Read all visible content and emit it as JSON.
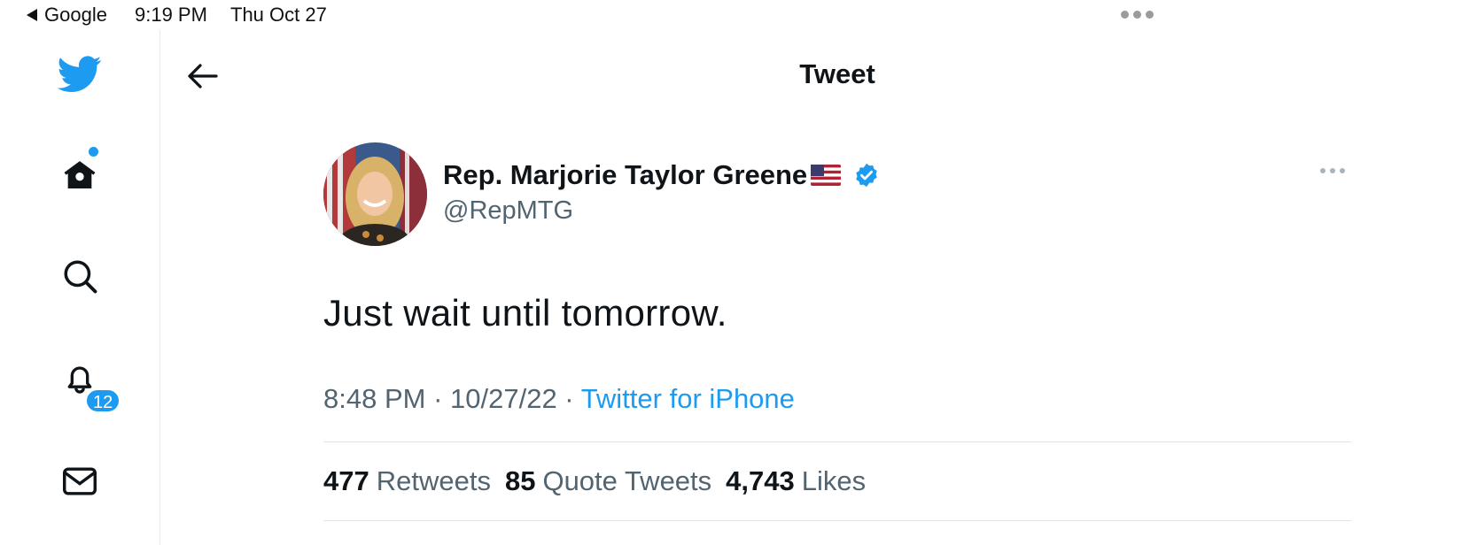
{
  "status_bar": {
    "back_app": "Google",
    "time": "9:19 PM",
    "date": "Thu Oct 27"
  },
  "sidebar": {
    "items": [
      {
        "icon": "twitter-bird-icon"
      },
      {
        "icon": "home-icon",
        "has_dot": true
      },
      {
        "icon": "search-icon"
      },
      {
        "icon": "bell-icon",
        "badge": "12"
      },
      {
        "icon": "mail-icon"
      }
    ]
  },
  "header": {
    "title": "Tweet"
  },
  "tweet": {
    "author_name": "Rep. Marjorie Taylor Greene",
    "handle": "@RepMTG",
    "text": "Just wait until tomorrow.",
    "time": "8:48 PM",
    "date": "10/27/22",
    "source": "Twitter for iPhone",
    "separator": " · "
  },
  "stats": {
    "retweets_count": "477",
    "retweets_label": "Retweets",
    "quotes_count": "85",
    "quotes_label": "Quote Tweets",
    "likes_count": "4,743",
    "likes_label": "Likes"
  },
  "colors": {
    "accent": "#1d9bf0",
    "text_primary": "#0f1419",
    "text_secondary": "#536471",
    "divider": "#dfe3e7"
  }
}
